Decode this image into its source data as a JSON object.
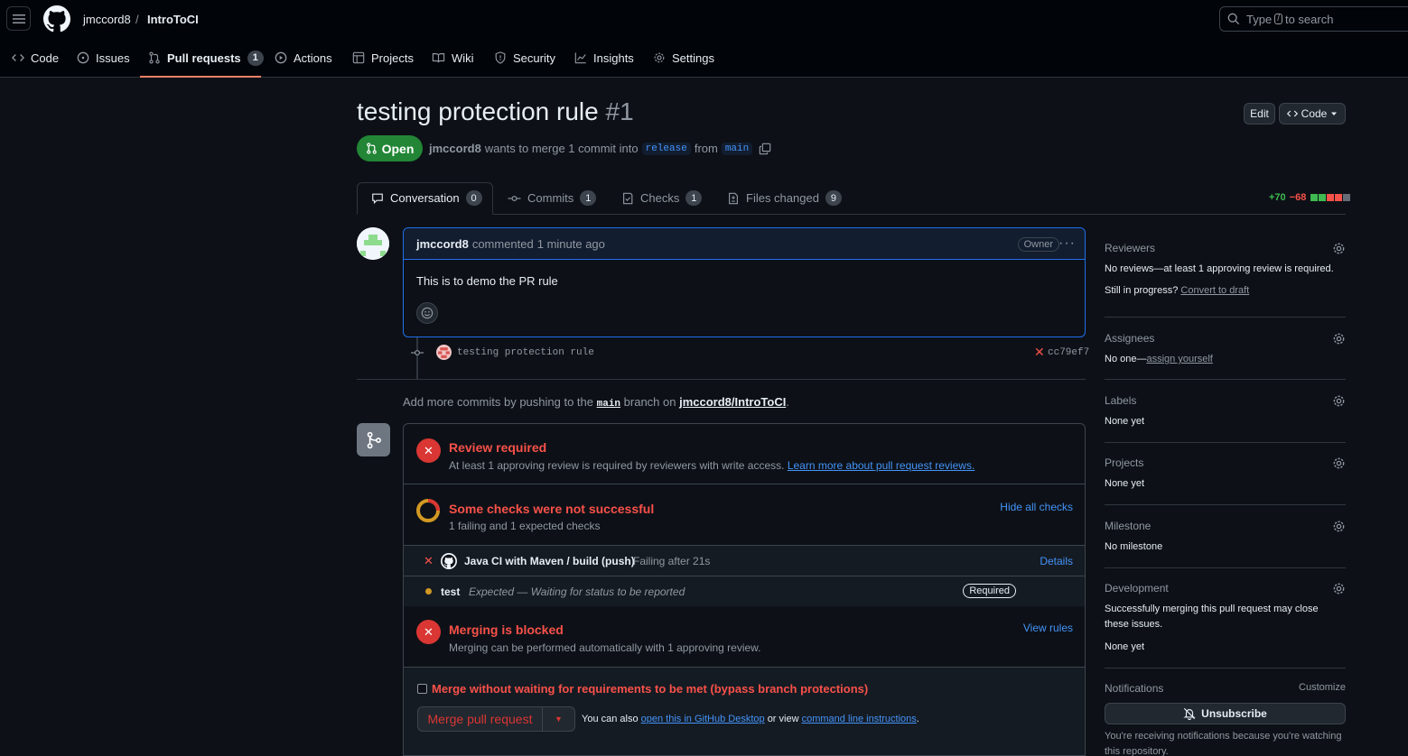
{
  "header": {
    "owner": "jmccord8",
    "separator": "/",
    "repo": "IntroToCI",
    "search_prefix": "Type",
    "search_key": "/",
    "search_suffix": "to search"
  },
  "repo_tabs": [
    {
      "label": "Code",
      "icon": "code-icon"
    },
    {
      "label": "Issues",
      "icon": "issue-icon"
    },
    {
      "label": "Pull requests",
      "icon": "pull-request-icon",
      "count": "1",
      "active": true
    },
    {
      "label": "Actions",
      "icon": "play-icon"
    },
    {
      "label": "Projects",
      "icon": "table-icon"
    },
    {
      "label": "Wiki",
      "icon": "book-icon"
    },
    {
      "label": "Security",
      "icon": "shield-icon"
    },
    {
      "label": "Insights",
      "icon": "graph-icon"
    },
    {
      "label": "Settings",
      "icon": "gear-icon"
    }
  ],
  "pr": {
    "title": "testing protection rule",
    "number": "#1",
    "state": "Open",
    "author": "jmccord8",
    "merge_text": "wants to merge 1 commit into",
    "base_branch": "release",
    "from_text": "from",
    "head_branch": "main",
    "edit_label": "Edit",
    "code_label": "Code"
  },
  "pr_tabs": [
    {
      "label": "Conversation",
      "count": "0",
      "icon": "comment-icon"
    },
    {
      "label": "Commits",
      "count": "1",
      "icon": "commit-icon"
    },
    {
      "label": "Checks",
      "count": "1",
      "icon": "checklist-icon"
    },
    {
      "label": "Files changed",
      "count": "9",
      "icon": "file-diff-icon"
    }
  ],
  "diffstat": {
    "additions": "+70",
    "deletions": "−68",
    "blocks": [
      "add",
      "add",
      "del",
      "del",
      "neutral"
    ]
  },
  "comment": {
    "author": "jmccord8",
    "action": "commented",
    "time": "1 minute ago",
    "role": "Owner",
    "body": "This is to demo the PR rule"
  },
  "commit": {
    "message": "testing protection rule",
    "sha": "cc79ef7"
  },
  "push_note": {
    "prefix": "Add more commits by pushing to the",
    "branch": "main",
    "middle": "branch on",
    "repo": "jmccord8/IntroToCI",
    "suffix": "."
  },
  "merge": {
    "review_title": "Review required",
    "review_sub": "At least 1 approving review is required by reviewers with write access.",
    "review_link": "Learn more about pull request reviews.",
    "checks_title": "Some checks were not successful",
    "checks_sub": "1 failing and 1 expected checks",
    "hide_checks": "Hide all checks",
    "checks": [
      {
        "name": "Java CI with Maven / build (push)",
        "status": "Failing after 21s",
        "action": "Details"
      },
      {
        "name": "test",
        "status": "Expected — Waiting for status to be reported",
        "badge": "Required"
      }
    ],
    "blocked_title": "Merging is blocked",
    "blocked_sub": "Merging can be performed automatically with 1 approving review.",
    "view_rules": "View rules",
    "bypass_label": "Merge without waiting for requirements to be met (bypass branch protections)",
    "merge_button": "Merge pull request",
    "also_prefix": "You can also",
    "desktop_link": "open this in GitHub Desktop",
    "or_view": "or view",
    "cli_link": "command line instructions",
    "period": "."
  },
  "sidebar": {
    "reviewers": {
      "title": "Reviewers",
      "value": "No reviews—at least 1 approving review is required.",
      "progress_label": "Still in progress?",
      "draft_link": "Convert to draft"
    },
    "assignees": {
      "title": "Assignees",
      "value": "No one—",
      "link": "assign yourself"
    },
    "labels": {
      "title": "Labels",
      "value": "None yet"
    },
    "projects": {
      "title": "Projects",
      "value": "None yet"
    },
    "milestone": {
      "title": "Milestone",
      "value": "No milestone"
    },
    "development": {
      "title": "Development",
      "value": "Successfully merging this pull request may close these issues.",
      "value2": "None yet"
    },
    "notifications": {
      "title": "Notifications",
      "customize": "Customize",
      "button": "Unsubscribe",
      "note": "You're receiving notifications because you're watching this repository."
    }
  },
  "colors": {
    "accent": "#4493f8",
    "danger": "#f85149",
    "success": "#238636",
    "pending": "#d29922"
  }
}
